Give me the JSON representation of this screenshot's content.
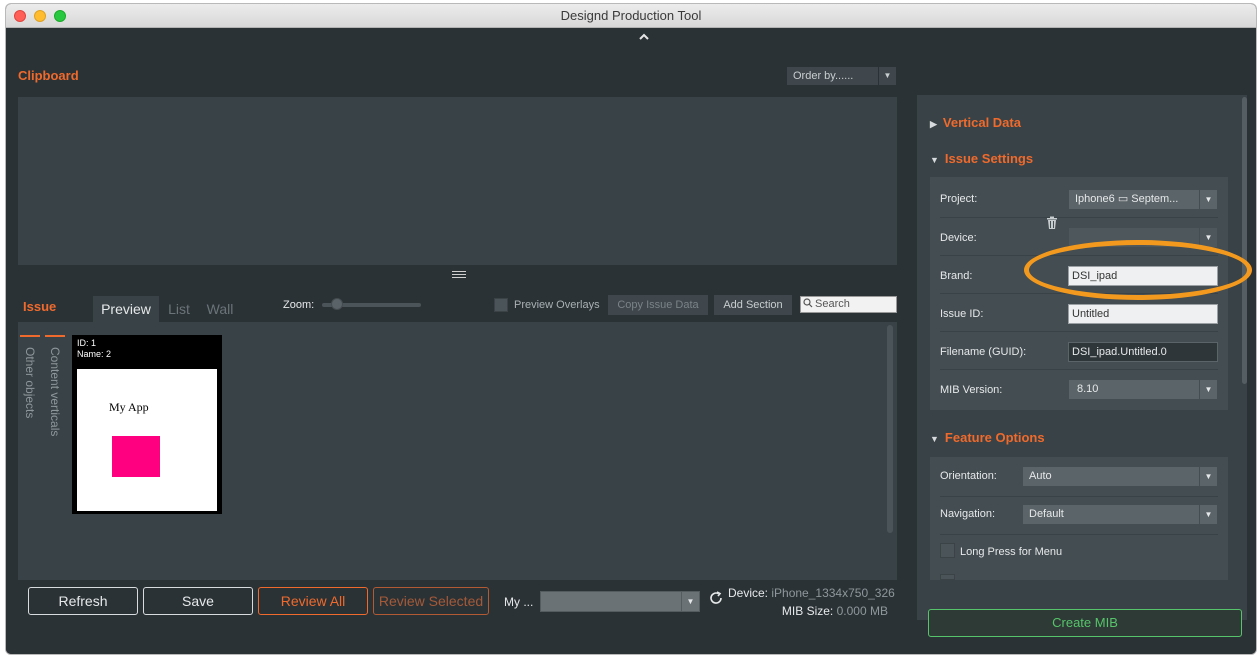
{
  "window": {
    "title": "Designd Production Tool"
  },
  "clipboard": {
    "title": "Clipboard",
    "order_by": "Order by......"
  },
  "issue": {
    "title": "Issue",
    "tabs": {
      "preview": "Preview",
      "list": "List",
      "wall": "Wall"
    },
    "zoom_label": "Zoom:",
    "zoom_value": 0.1,
    "preview_overlays": "Preview Overlays",
    "copy_issue_data": "Copy Issue Data",
    "add_section": "Add Section",
    "search_placeholder": "Search",
    "vtabs": {
      "other_objects": "Other objects",
      "content_verticals": "Content verticals"
    },
    "card": {
      "id": "ID: 1",
      "name": "Name: 2",
      "app_name": "My App"
    }
  },
  "bottom": {
    "refresh": "Refresh",
    "save": "Save",
    "review_all": "Review All",
    "review_selected": "Review Selected",
    "my_label": "My ...",
    "device_label": "Device:",
    "device_value": "iPhone_1334x750_326",
    "mib_size_label": "MIB Size:",
    "mib_size_value": "0.000 MB"
  },
  "right": {
    "vertical_data": "Vertical Data",
    "issue_settings": "Issue Settings",
    "fields": {
      "project_label": "Project:",
      "project_value": "Iphone6 ▭ Septem...",
      "device_label": "Device:",
      "brand_label": "Brand:",
      "brand_value": "DSI_ipad",
      "issue_id_label": "Issue ID:",
      "issue_id_value": "Untitled",
      "filename_label": "Filename (GUID):",
      "filename_value": "DSI_ipad.Untitled.0",
      "mib_version_label": "MIB Version:",
      "mib_version_value": "8.10"
    },
    "feature_options": "Feature Options",
    "features": {
      "orientation_label": "Orientation:",
      "orientation_value": "Auto",
      "navigation_label": "Navigation:",
      "navigation_value": "Default",
      "long_press": "Long Press for Menu"
    },
    "create_mib": "Create MIB"
  },
  "colors": {
    "accent": "#ef6a2c",
    "create": "#56c46a",
    "highlight": "#f39a1e",
    "card_box": "#ff0080"
  }
}
